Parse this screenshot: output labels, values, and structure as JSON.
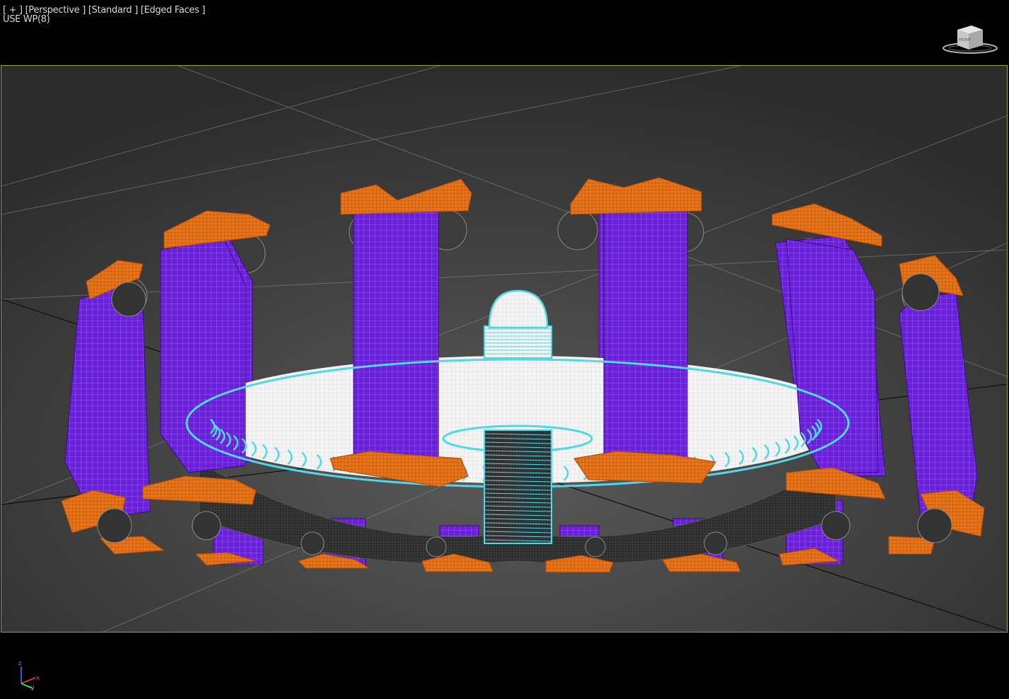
{
  "viewport": {
    "label_menu": "[ + ]",
    "label_view": "[Perspective ]",
    "label_shading": "[Standard ]",
    "label_display": "[Edged Faces ]",
    "subtitle": "USE WP(8)"
  },
  "viewcube": {
    "face": "FRONT",
    "icon": "viewcube-icon"
  },
  "axis_tripod": {
    "icon": "axis-tripod-icon",
    "x": "x",
    "y": "y",
    "z": "z"
  },
  "colors": {
    "viewport_bg": "#2f2f2f",
    "frame_border": "#a89a3e",
    "purple": "#6a1fd8",
    "orange": "#e8741a",
    "cyan": "#4fd8e8",
    "white": "#f2f2f2",
    "grid": "#8a8a8a"
  }
}
